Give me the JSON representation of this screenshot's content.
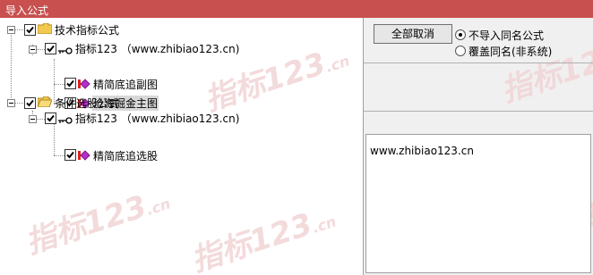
{
  "window": {
    "title": "导入公式"
  },
  "watermark": {
    "text": "指标123",
    "suffix": ".cn"
  },
  "tree": {
    "groups": [
      {
        "label": "技术指标公式",
        "checked": true,
        "source": {
          "label": "指标123",
          "url": "（www.zhibiao123.cn)",
          "checked": true
        },
        "items": [
          {
            "label": "精简底追副图",
            "checked": true,
            "selected": false
          },
          {
            "label": "沧海掘金主图",
            "checked": true,
            "selected": true
          }
        ]
      },
      {
        "label": "条件选股公式",
        "checked": true,
        "source": {
          "label": "指标123",
          "url": "（www.zhibiao123.cn)",
          "checked": true
        },
        "items": [
          {
            "label": "精简底追选股",
            "checked": true,
            "selected": false
          }
        ]
      }
    ]
  },
  "actions": {
    "deselect_all": "全部取消"
  },
  "options": [
    {
      "label": "不导入同名公式",
      "selected": true
    },
    {
      "label": "覆盖同名(非系统)",
      "selected": false
    }
  ],
  "info": {
    "text": "www.zhibiao123.cn"
  },
  "colors": {
    "titlebar": "#c8504f",
    "diamond": "#b62fc9",
    "folder": "#f2c94c"
  }
}
